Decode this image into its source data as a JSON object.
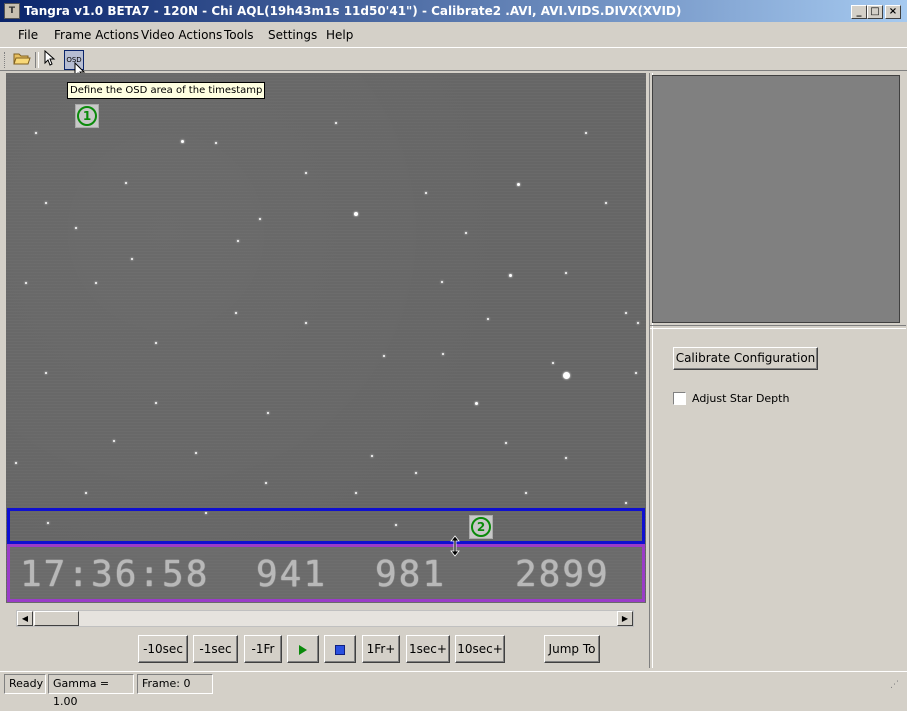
{
  "window": {
    "title": "Tangra v1.0 BETA7 - 120N - Chi AQL(19h43m1s 11d50'41\") - Calibrate2 .AVI, AVI.VIDS.DIVX(XVID)",
    "icon": "app-icon",
    "controls": [
      "_",
      "□",
      "×"
    ]
  },
  "menu": [
    {
      "label": "File"
    },
    {
      "label": "Frame Actions"
    },
    {
      "label": "Video Actions"
    },
    {
      "label": "Tools"
    },
    {
      "label": "Settings"
    },
    {
      "label": "Help"
    }
  ],
  "toolbar": {
    "open_icon": "folder-open-icon",
    "select_icon": "arrow-pointer-icon",
    "osd_label": "OSD",
    "tooltip": "Define the OSD area of the timestamp"
  },
  "video": {
    "marker1": "1",
    "marker2": "2",
    "osd_timestamp": [
      "17:36:58",
      "941",
      "981",
      "2899"
    ]
  },
  "controls": {
    "minus10sec": "-10sec",
    "minus1sec": "-1sec",
    "minus1fr": "-1Fr",
    "play_icon": "play-icon",
    "stop_icon": "stop-icon",
    "plus1fr": "1Fr+",
    "plus1sec": "1sec+",
    "plus10sec": "10sec+",
    "jump_to": "Jump To"
  },
  "right_panel": {
    "calibrate_button": "Calibrate Configuration",
    "adjust_star_depth": "Adjust Star Depth",
    "adjust_star_depth_checked": false
  },
  "status": {
    "state": "Ready",
    "gamma": "Gamma = 1.00",
    "frame": "Frame: 0"
  },
  "colors": {
    "osd_band_upper": "#1010d0",
    "osd_band_lower": "#9a3cc8",
    "marker": "#0a8a0a"
  }
}
